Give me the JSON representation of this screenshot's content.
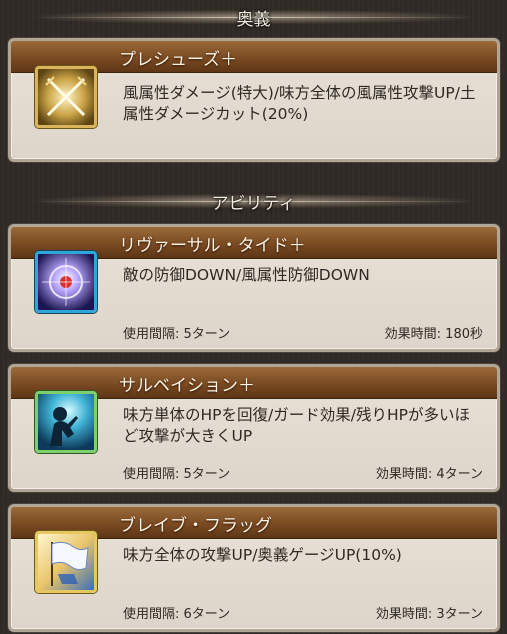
{
  "ougi_section": {
    "title": "奥義"
  },
  "ability_section": {
    "title": "アビリティ"
  },
  "ougi": {
    "name": "プレシューズ＋",
    "description": "風属性ダメージ(特大)/味方全体の風属性攻撃UP/土属性ダメージカット(20%)",
    "icon": "crossed-swords-icon"
  },
  "abilities": [
    {
      "name": "リヴァーサル・タイド＋",
      "description": "敵の防御DOWN/風属性防御DOWN",
      "cooldown": "使用間隔: 5ターン",
      "duration": "効果時間: 180秒",
      "icon": "reversal-orb-icon",
      "frame_color": "#2ea6d9"
    },
    {
      "name": "サルベイション＋",
      "description": "味方単体のHPを回復/ガード効果/残りHPが多いほど攻撃が大きくUP",
      "cooldown": "使用間隔: 5ターン",
      "duration": "効果時間: 4ターン",
      "icon": "praying-figure-icon",
      "frame_color": "#7dcf6a"
    },
    {
      "name": "ブレイブ・フラッグ",
      "description": "味方全体の攻撃UP/奥義ゲージUP(10%)",
      "cooldown": "使用間隔: 6ターン",
      "duration": "効果時間: 3ターン",
      "icon": "flag-icon",
      "frame_color": "#e6c860"
    }
  ]
}
